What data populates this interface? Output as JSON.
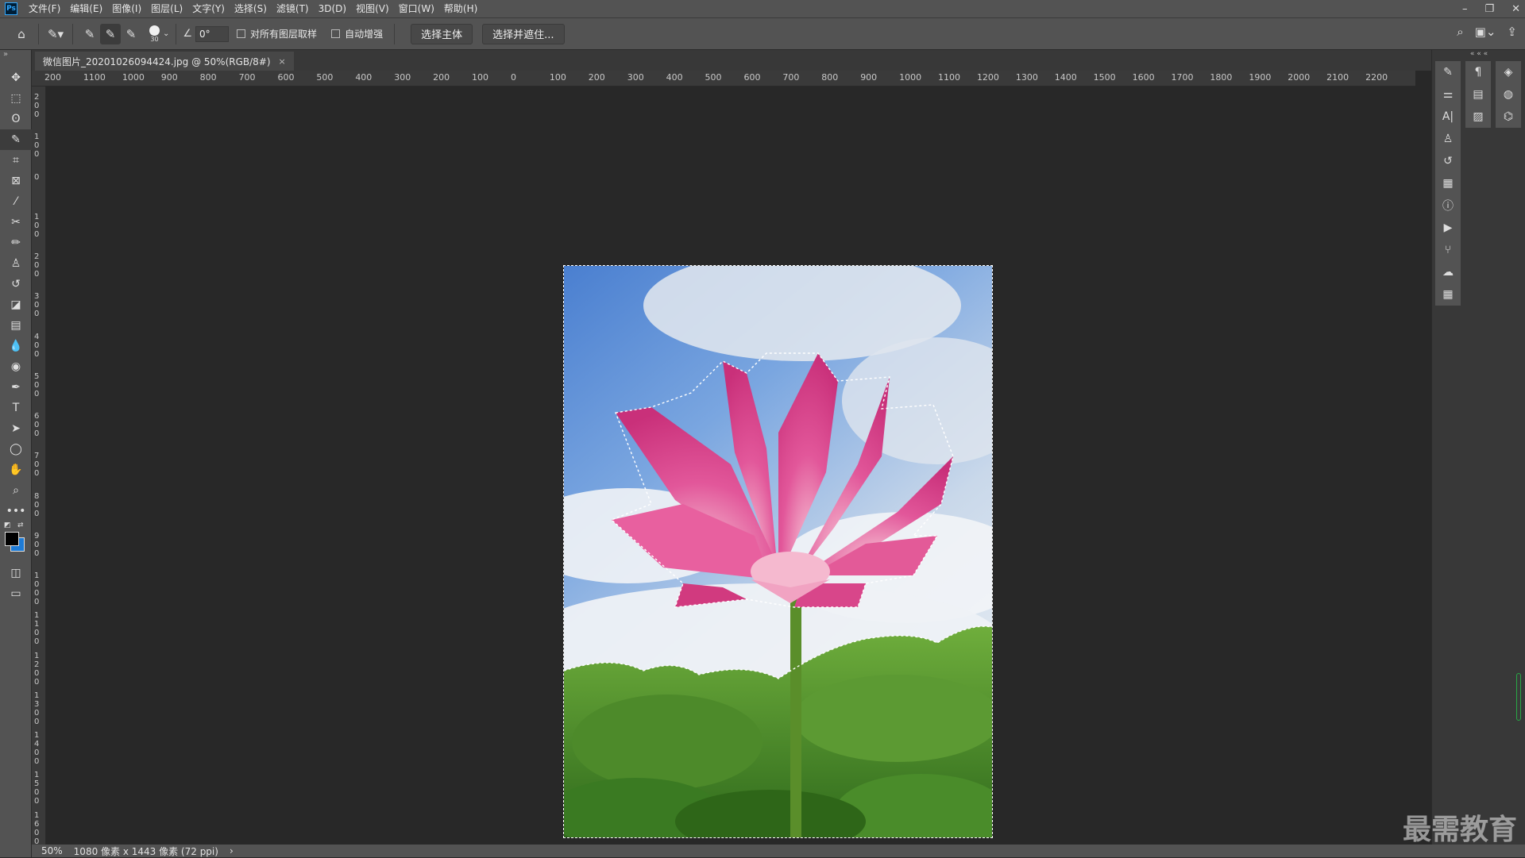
{
  "app": {
    "logo": "Ps"
  },
  "menu": [
    "文件(F)",
    "编辑(E)",
    "图像(I)",
    "图层(L)",
    "文字(Y)",
    "选择(S)",
    "滤镜(T)",
    "3D(D)",
    "视图(V)",
    "窗口(W)",
    "帮助(H)"
  ],
  "options": {
    "brush_size": "30",
    "angle": "0°",
    "sample_all_layers": "对所有图层取样",
    "auto_enhance": "自动增强",
    "select_subject": "选择主体",
    "select_and_mask": "选择并遮住..."
  },
  "document": {
    "tab_title": "微信图片_20201026094424.jpg @ 50%(RGB/8#)",
    "close_glyph": "×"
  },
  "ruler": {
    "h_labels": [
      "200",
      "1100",
      "1000",
      "900",
      "800",
      "700",
      "600",
      "500",
      "400",
      "300",
      "200",
      "100",
      "0",
      "100",
      "200",
      "300",
      "400",
      "500",
      "600",
      "700",
      "800",
      "900",
      "1000",
      "1100",
      "1200",
      "1300",
      "1400",
      "1500",
      "1600",
      "1700",
      "1800",
      "1900",
      "2000",
      "2100",
      "2200"
    ],
    "v_labels": [
      "2 0 0",
      "1 0 0",
      "0",
      "1 0 0",
      "2 0 0",
      "3 0 0",
      "4 0 0",
      "5 0 0",
      "6 0 0",
      "7 0 0",
      "8 0 0",
      "9 0 0",
      "1 0 0 0",
      "1 1 0 0",
      "1 2 0 0",
      "1 3 0 0",
      "1 4 0 0",
      "1 5 0 0",
      "1 6 0 0"
    ]
  },
  "status": {
    "zoom": "50%",
    "doc_info": "1080 像素 x 1443 像素 (72 ppi)",
    "arrow": "›"
  },
  "watermark": "最需教育",
  "colors": {
    "foreground": "#000000",
    "background": "#1e7bd6"
  }
}
